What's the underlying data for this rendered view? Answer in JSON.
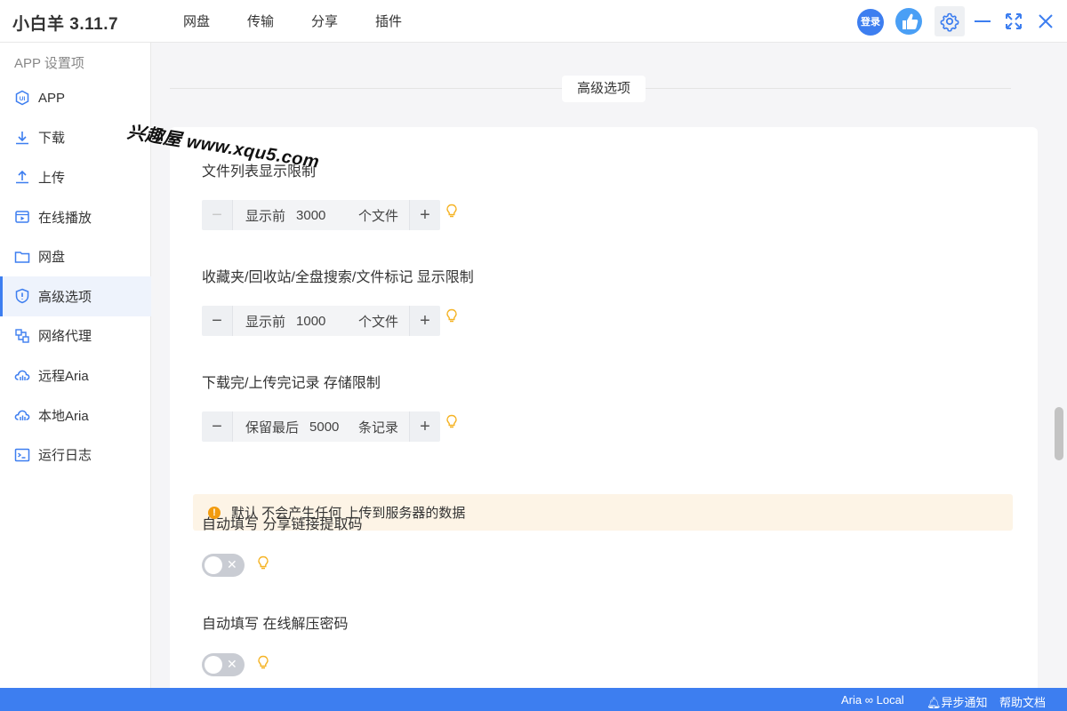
{
  "app": {
    "title": "小白羊 3.11.7"
  },
  "nav": {
    "items": [
      "网盘",
      "传输",
      "分享",
      "插件"
    ]
  },
  "header": {
    "login_label": "登录"
  },
  "sidebar": {
    "heading": "APP 设置项",
    "items": [
      {
        "label": "APP",
        "icon": "app-ui-icon"
      },
      {
        "label": "下载",
        "icon": "download-icon"
      },
      {
        "label": "上传",
        "icon": "upload-icon"
      },
      {
        "label": "在线播放",
        "icon": "video-icon"
      },
      {
        "label": "网盘",
        "icon": "folder-icon"
      },
      {
        "label": "高级选项",
        "icon": "shield-icon",
        "active": true
      },
      {
        "label": "网络代理",
        "icon": "network-icon"
      },
      {
        "label": "远程Aria",
        "icon": "cloud-icon"
      },
      {
        "label": "本地Aria",
        "icon": "cloud-icon"
      },
      {
        "label": "运行日志",
        "icon": "terminal-icon"
      }
    ]
  },
  "main": {
    "section_title": "高级选项",
    "settings": [
      {
        "label": "文件列表显示限制",
        "prefix": "显示前",
        "value": "3000",
        "suffix": "个文件"
      },
      {
        "label": "收藏夹/回收站/全盘搜索/文件标记 显示限制",
        "prefix": "显示前",
        "value": "1000",
        "suffix": "个文件"
      },
      {
        "label": "下载完/上传完记录 存储限制",
        "prefix": "保留最后",
        "value": "5000",
        "suffix": "条记录"
      }
    ],
    "notice": "默认 不会产生任何 上传到服务器的数据",
    "toggles": [
      {
        "label": "自动填写 分享链接提取码",
        "on": false
      },
      {
        "label": "自动填写 在线解压密码",
        "on": false
      }
    ]
  },
  "watermark": "兴趣屋 www.xqu5.com",
  "statusbar": {
    "aria": "Aria ∞ Local",
    "notify": "异步通知",
    "help": "帮助文档"
  },
  "colors": {
    "accent": "#3d7ef0",
    "warning": "#f29b0e",
    "notice_bg": "#fdf4e6",
    "bulb": "#f5b324"
  }
}
